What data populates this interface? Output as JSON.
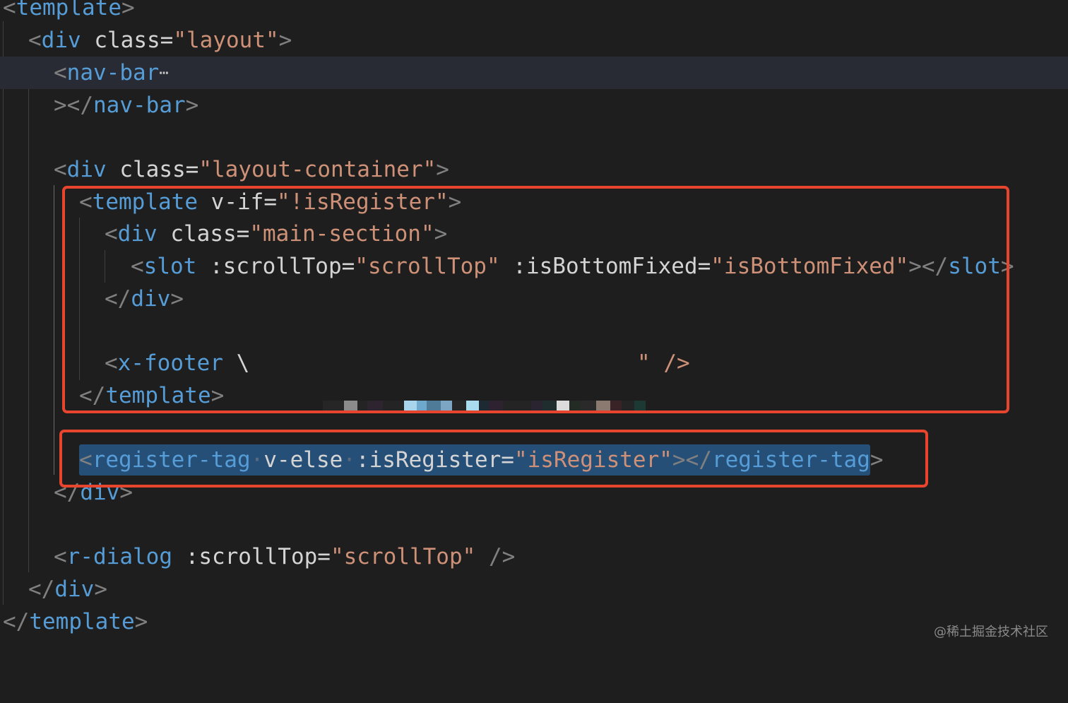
{
  "editor": {
    "lines": [
      {
        "open": "<",
        "tag": "template",
        "close": ">"
      },
      {
        "open": "<",
        "tag": "div",
        "attr1": "class",
        "eq1": "=",
        "val1": "\"layout\"",
        "close": ">"
      },
      {
        "open": "<",
        "tag": "nav-bar",
        "fold": "⋯"
      },
      {
        "open": "></",
        "tag": "nav-bar",
        "close": ">"
      },
      {
        "open": "<",
        "tag": "div",
        "attr1": "class",
        "eq1": "=",
        "val1": "\"layout-container\"",
        "close": ">"
      },
      {
        "open": "<",
        "tag": "template",
        "attr1": "v-if",
        "eq1": "=",
        "val1": "\"!isRegister\"",
        "close": ">"
      },
      {
        "open": "<",
        "tag": "div",
        "attr1": "class",
        "eq1": "=",
        "val1": "\"main-section\"",
        "close": ">"
      },
      {
        "open": "<",
        "tag": "slot",
        "attr1": ":scrollTop",
        "eq1": "=",
        "val1": "\"scrollTop\"",
        "attr2": ":isBottomFixed",
        "eq2": "=",
        "val2": "\"isBottomFixed\"",
        "close": "></",
        "tag2": "slot",
        "close2": ">"
      },
      {
        "open": "</",
        "tag": "div",
        "close": ">"
      },
      {
        "open": "<",
        "tag": "x-footer",
        "partial": "\\",
        "tail": "\" />"
      },
      {
        "open": "</",
        "tag": "template",
        "close": ">"
      },
      {
        "open": "<",
        "tag": "register-tag",
        "attr1": "v-else",
        "attr2": ":isRegister",
        "eq2": "=",
        "val2": "\"isRegister\"",
        "close": "></",
        "tag2": "register-tag",
        "close2": ">"
      },
      {
        "open": "</",
        "tag": "div",
        "close": ">"
      },
      {
        "open": "<",
        "tag": "r-dialog",
        "attr1": ":scrollTop",
        "eq1": "=",
        "val1": "\"scrollTop\"",
        "close": " />"
      },
      {
        "open": "</",
        "tag": "div",
        "close": ">"
      },
      {
        "open": "</",
        "tag": "template",
        "close": ">"
      }
    ],
    "whitespace_dot": "·"
  },
  "watermark": "@稀土掘金技术社区",
  "colors": {
    "background": "#1e1e1e",
    "tag": "#569cd6",
    "string": "#ce9178",
    "punctuation": "#808080",
    "attribute": "#d4d4d4",
    "selection": "#264f78",
    "highlight_box": "#e8452f"
  }
}
